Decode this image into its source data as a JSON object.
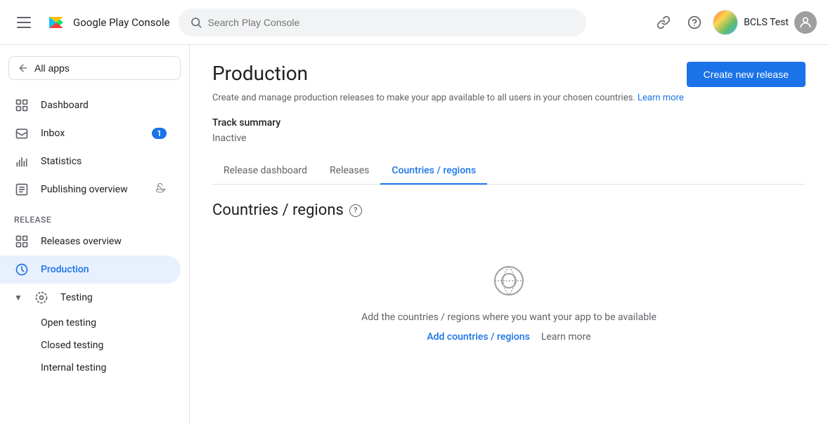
{
  "app": {
    "title": "Google Play Console",
    "logo_text_plain": "Google Play",
    "logo_text_brand": "Console"
  },
  "nav": {
    "search_placeholder": "Search Play Console",
    "user_name": "BCLS Test",
    "link_icon": "🔗",
    "help_icon": "?"
  },
  "sidebar": {
    "all_apps_label": "All apps",
    "items": [
      {
        "id": "dashboard",
        "label": "Dashboard"
      },
      {
        "id": "inbox",
        "label": "Inbox",
        "badge": "1"
      },
      {
        "id": "statistics",
        "label": "Statistics"
      },
      {
        "id": "publishing-overview",
        "label": "Publishing overview",
        "mute": true
      }
    ],
    "release_section_label": "Release",
    "release_items": [
      {
        "id": "releases-overview",
        "label": "Releases overview"
      },
      {
        "id": "production",
        "label": "Production",
        "active": true
      },
      {
        "id": "testing",
        "label": "Testing",
        "expandable": true
      }
    ],
    "testing_sub_items": [
      {
        "id": "open-testing",
        "label": "Open testing"
      },
      {
        "id": "closed-testing",
        "label": "Closed testing"
      },
      {
        "id": "internal-testing",
        "label": "Internal testing"
      }
    ]
  },
  "page": {
    "title": "Production",
    "description": "Create and manage production releases to make your app available to all users in your chosen countries.",
    "learn_more": "Learn more",
    "create_release_btn": "Create new release",
    "track_summary_label": "Track summary",
    "track_status": "Inactive"
  },
  "tabs": [
    {
      "id": "release-dashboard",
      "label": "Release dashboard"
    },
    {
      "id": "releases",
      "label": "Releases"
    },
    {
      "id": "countries-regions",
      "label": "Countries / regions",
      "active": true
    }
  ],
  "countries_section": {
    "title": "Countries / regions",
    "empty_text": "Add the countries / regions where you want your app to be available",
    "add_link": "Add countries / regions",
    "learn_more": "Learn more"
  }
}
